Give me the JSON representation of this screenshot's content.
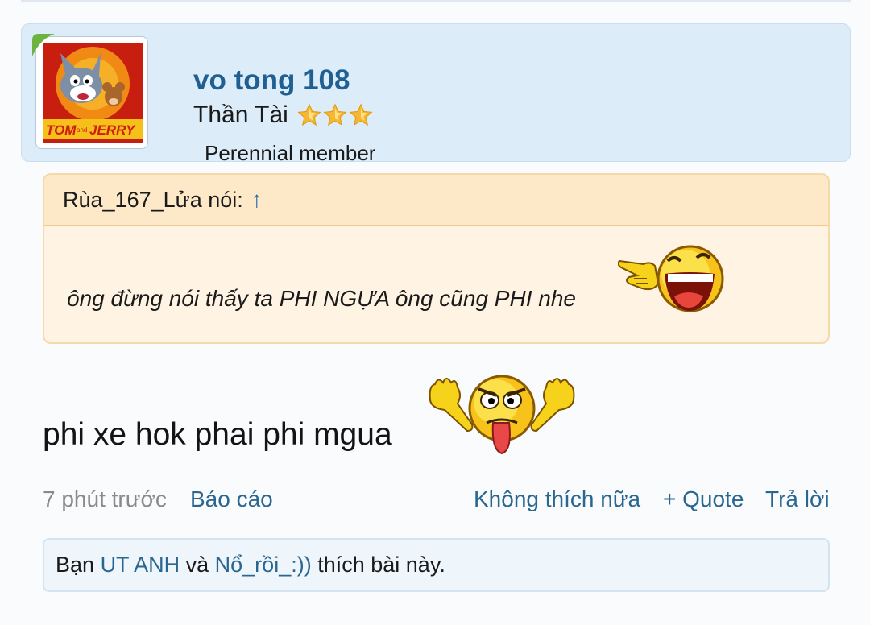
{
  "post": {
    "author": {
      "username": "vo tong 108",
      "rank": "Thần Tài",
      "star_count": 3,
      "member_title": "Perennial member",
      "avatar_icon": "tom-and-jerry-avatar"
    },
    "quote": {
      "header": "Rùa_167_Lửa nói:",
      "jump_icon": "↑",
      "text": "ông đừng nói thấy ta PHI NGỰA ông cũng PHI nhe",
      "emoticon": "laughing-pointing-smiley"
    },
    "body": {
      "text": "phi xe hok phai phi mgua",
      "emoticon": "tongue-out-smiley"
    },
    "meta": {
      "time": "7 phút trước",
      "report": "Báo cáo",
      "unlike": "Không thích nữa",
      "quote": "+ Quote",
      "reply": "Trả lời"
    },
    "likes": {
      "prefix": "Bạn",
      "user1": "UT ANH",
      "and": "và",
      "user2": "Nổ_rồi_:))",
      "suffix": "thích bài này."
    }
  },
  "colors": {
    "username": "#1f5f91",
    "link": "#2a6790",
    "user_card_bg": "#dcecf9",
    "quote_bg": "#fff3e3",
    "quote_header_bg": "#fde8c8"
  }
}
